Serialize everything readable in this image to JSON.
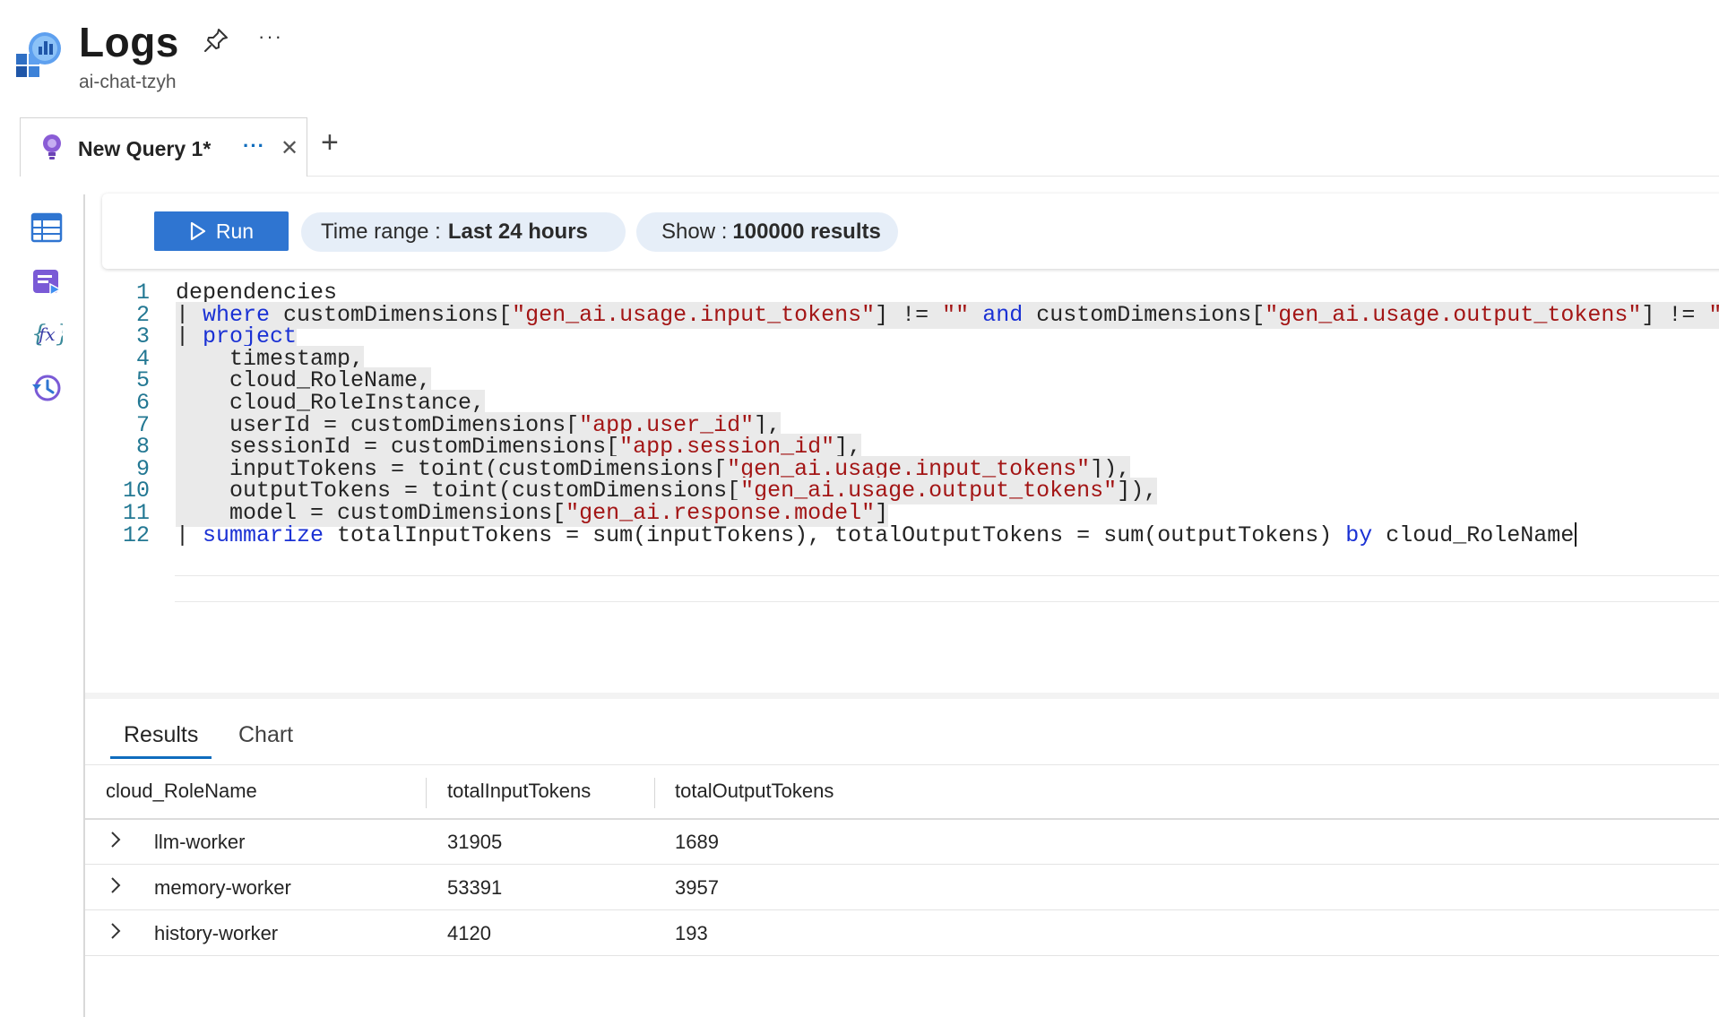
{
  "header": {
    "title": "Logs",
    "subtitle": "ai-chat-tzyh",
    "more_label": "···"
  },
  "tabs": [
    {
      "label": "New Query 1*",
      "more_label": "···",
      "close_label": "✕"
    }
  ],
  "add_tab_label": "+",
  "toolbar": {
    "run_label": "Run",
    "time_range_label": "Time range :",
    "time_range_value": "Last 24 hours",
    "show_label": "Show :",
    "show_value": "100000 results"
  },
  "editor": {
    "line_numbers": [
      "1",
      "2",
      "3",
      "4",
      "5",
      "6",
      "7",
      "8",
      "9",
      "10",
      "11",
      "12"
    ],
    "lines": [
      "dependencies",
      "| where customDimensions[\"gen_ai.usage.input_tokens\"] != \"\" and customDimensions[\"gen_ai.usage.output_tokens\"] != \"\"",
      "| project",
      "    timestamp,",
      "    cloud_RoleName,",
      "    cloud_RoleInstance,",
      "    userId = customDimensions[\"app.user_id\"],",
      "    sessionId = customDimensions[\"app.session_id\"],",
      "    inputTokens = toint(customDimensions[\"gen_ai.usage.input_tokens\"]),",
      "    outputTokens = toint(customDimensions[\"gen_ai.usage.output_tokens\"]),",
      "    model = customDimensions[\"gen_ai.response.model\"]",
      "| summarize totalInputTokens = sum(inputTokens), totalOutputTokens = sum(outputTokens) by cloud_RoleName"
    ],
    "keywords": [
      "where",
      "and",
      "project",
      "summarize",
      "by"
    ]
  },
  "results": {
    "tabs": [
      "Results",
      "Chart"
    ],
    "columns": [
      "cloud_RoleName",
      "totalInputTokens",
      "totalOutputTokens"
    ],
    "rows": [
      [
        "llm-worker",
        "31905",
        "1689"
      ],
      [
        "memory-worker",
        "53391",
        "3957"
      ],
      [
        "history-worker",
        "4120",
        "193"
      ]
    ]
  },
  "colors": {
    "accent": "#0f6cbd",
    "run_button": "#2f75d1",
    "pill_bg": "#e6eef8",
    "keyword": "#1a31d4",
    "string": "#a31515",
    "line_number": "#237893"
  },
  "icons": {
    "app": "logs-analytics-icon",
    "pin": "pin-icon",
    "tab": "query-bulb-icon",
    "rail": [
      "tables-icon",
      "queries-icon",
      "functions-icon",
      "history-icon"
    ],
    "run": "play-icon",
    "row_expander": "chevron-right-icon"
  }
}
